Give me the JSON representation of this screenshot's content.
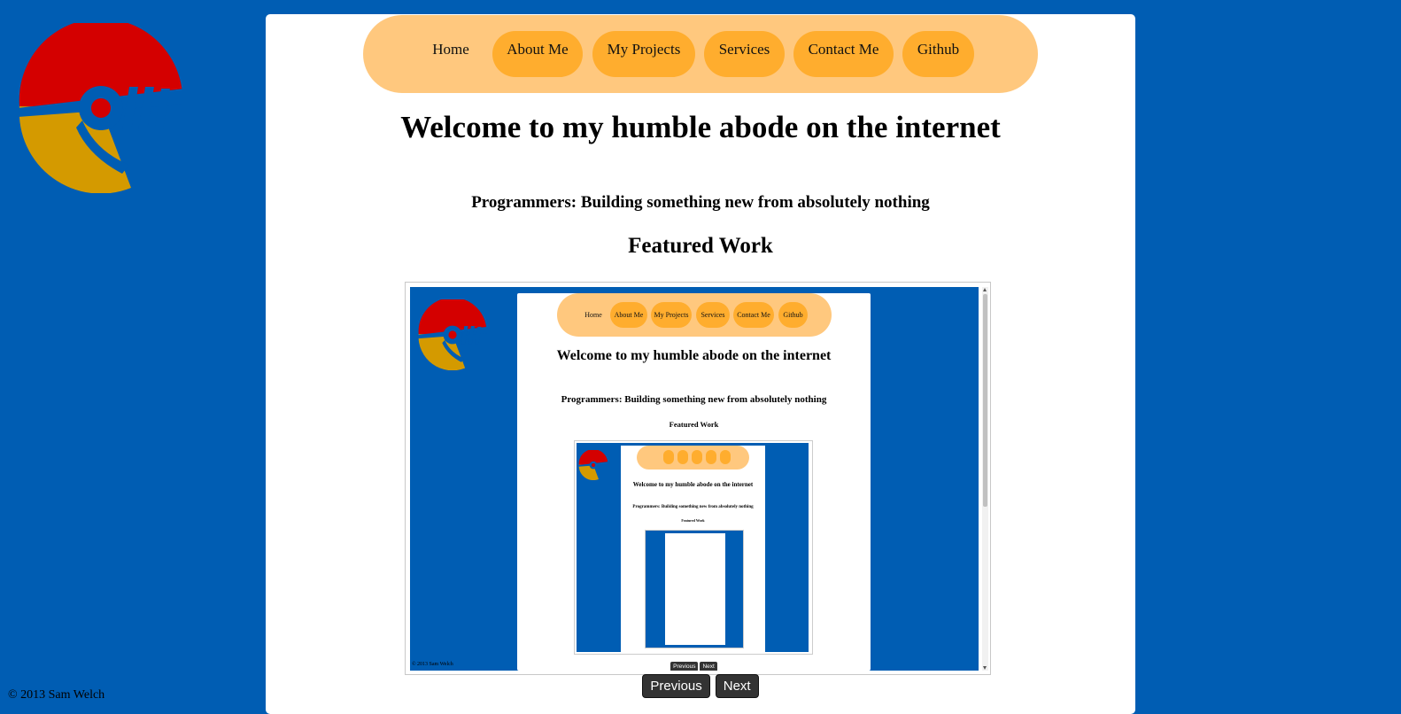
{
  "nav": {
    "items": [
      {
        "label": "Home"
      },
      {
        "label": "About Me"
      },
      {
        "label": "My Projects"
      },
      {
        "label": "Services"
      },
      {
        "label": "Contact Me"
      },
      {
        "label": "Github"
      }
    ]
  },
  "main": {
    "title": "Welcome to my humble abode on the internet",
    "tagline": "Programmers: Building something new from absolutely nothing",
    "featured_heading": "Featured Work"
  },
  "slideshow": {
    "previous_label": "Previous",
    "next_label": "Next",
    "preview": {
      "nav_items": [
        "Home",
        "About Me",
        "My Projects",
        "Services",
        "Contact Me",
        "Github"
      ],
      "title": "Welcome to my humble abode on the internet",
      "tagline": "Programmers: Building something new from absolutely nothing",
      "featured_heading": "Featured Work",
      "copyright": "© 2013 Sam Welch",
      "previous_label": "Previous",
      "next_label": "Next"
    }
  },
  "footer": {
    "copyright": "© 2013 Sam Welch"
  },
  "colors": {
    "background": "#005db3",
    "nav_bar": "#ffc87e",
    "nav_button": "#ffad2e",
    "logo_red": "#d40000",
    "logo_gold": "#d49a00"
  }
}
